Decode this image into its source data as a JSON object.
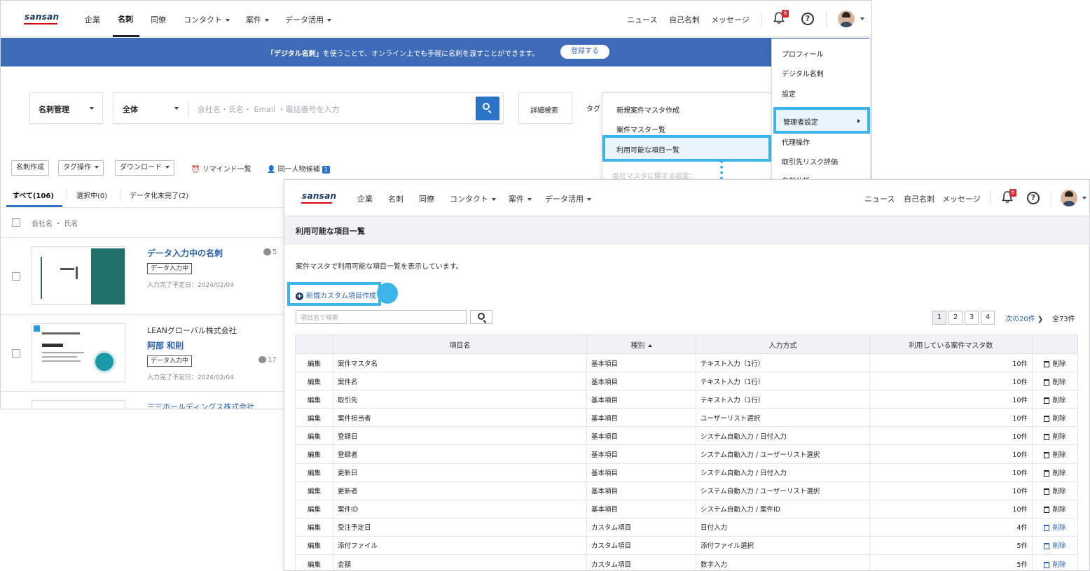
{
  "logo": "sansan",
  "nav": {
    "items": [
      {
        "label": "企業",
        "dropdown": false
      },
      {
        "label": "名刺",
        "dropdown": false
      },
      {
        "label": "同僚",
        "dropdown": false
      },
      {
        "label": "コンタクト",
        "dropdown": true
      },
      {
        "label": "案件",
        "dropdown": true
      },
      {
        "label": "データ活用",
        "dropdown": true
      }
    ],
    "active": "名刺",
    "right": [
      "ニュース",
      "自己名刺",
      "メッセージ"
    ],
    "notification_count": "6"
  },
  "banner": {
    "highlight": "「デジタル名刺」",
    "text": "を使うことで、オンライン上でも手軽に名刺を渡すことができます。",
    "button": "登録する"
  },
  "search": {
    "scope": "名刺管理",
    "filter": "全体",
    "placeholder": "会社名・氏名・ Email ・電話番号を入力",
    "advanced": "詳細検索",
    "tag_label": "タグ"
  },
  "toolbar": {
    "create": "名刺作成",
    "tag_ops": "タグ操作",
    "download": "ダウンロード",
    "reminder": "リマインド一覧",
    "duplicate": "同一人物候補",
    "duplicate_count": "1"
  },
  "tabs": [
    "すべて(106)",
    "選択中(0)",
    "データ化未完了(2)"
  ],
  "list_header": "会社名 ・ 氏名",
  "cards": [
    {
      "company": "",
      "name": "データ入力中の名刺",
      "status": "データ入力中",
      "date": "入力完了予定日：2024/02/04",
      "comments": "5"
    },
    {
      "company": "LEANグローバル株式会社",
      "name": "阿部 和則",
      "status": "データ入力中",
      "date": "入力完了予定日：2024/02/04",
      "comments": "17"
    },
    {
      "company": "三三ホールディングス株式会社",
      "name": "",
      "status": "",
      "date": "",
      "comments": ""
    }
  ],
  "anken_menu": {
    "items": [
      "新規案件マスタ作成",
      "案件マスター覧",
      "利用可能な項目一覧"
    ],
    "section": "会社マスタに関する設定："
  },
  "user_menu": {
    "items": [
      "プロフィール",
      "デジタル名刺",
      "設定",
      "管理者設定",
      "代理操作",
      "取引先リスク評価",
      "名刺分析"
    ]
  },
  "items_page": {
    "title": "利用可能な項目一覧",
    "description": "案件マスタで利用可能な項目一覧を表示しています。",
    "new_button": "新規カスタム項目作成",
    "search_placeholder": "項目名で検索",
    "pages": [
      "1",
      "2",
      "3",
      "4"
    ],
    "next": "次の20件",
    "total": "全73件",
    "columns": [
      "",
      "項目名",
      "種別",
      "入力方式",
      "利用している案件マスタ数",
      ""
    ],
    "edit_label": "編集",
    "delete_label": "削除",
    "rows": [
      {
        "name": "案件マスタ名",
        "type": "基本項目",
        "input": "テキスト入力（1行）",
        "count": "10件",
        "deletable": false
      },
      {
        "name": "案件名",
        "type": "基本項目",
        "input": "テキスト入力（1行）",
        "count": "10件",
        "deletable": false
      },
      {
        "name": "取引先",
        "type": "基本項目",
        "input": "テキスト入力（1行）",
        "count": "10件",
        "deletable": false
      },
      {
        "name": "案件担当者",
        "type": "基本項目",
        "input": "ユーザーリスト選択",
        "count": "10件",
        "deletable": false
      },
      {
        "name": "登録日",
        "type": "基本項目",
        "input": "システム自動入力 / 日付入力",
        "count": "10件",
        "deletable": false
      },
      {
        "name": "登録者",
        "type": "基本項目",
        "input": "システム自動入力 / ユーザーリスト選択",
        "count": "10件",
        "deletable": false
      },
      {
        "name": "更新日",
        "type": "基本項目",
        "input": "システム自動入力 / 日付入力",
        "count": "10件",
        "deletable": false
      },
      {
        "name": "更新者",
        "type": "基本項目",
        "input": "システム自動入力 / ユーザーリスト選択",
        "count": "10件",
        "deletable": false
      },
      {
        "name": "案件ID",
        "type": "基本項目",
        "input": "システム自動入力 / 案件ID",
        "count": "10件",
        "deletable": false
      },
      {
        "name": "受注予定日",
        "type": "カスタム項目",
        "input": "日付入力",
        "count": "4件",
        "deletable": true
      },
      {
        "name": "添付ファイル",
        "type": "カスタム項目",
        "input": "添付ファイル選択",
        "count": "5件",
        "deletable": true
      },
      {
        "name": "金額",
        "type": "カスタム項目",
        "input": "数字入力",
        "count": "5件",
        "deletable": true
      }
    ]
  },
  "colors": {
    "brand": "#1d3a66",
    "accent": "#2a73c9",
    "highlight": "#3bb5ea",
    "banner": "#3d6bb8",
    "alert": "#e0262c"
  }
}
